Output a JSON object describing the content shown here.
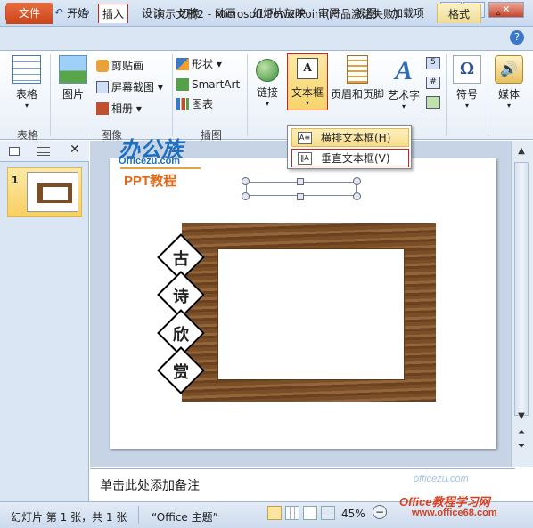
{
  "titlebar": {
    "app_icon": "P",
    "title": "演示文稿2 - Microsoft PowerPoint(产品激活失败)",
    "min": "–",
    "max": "□",
    "close": "✕"
  },
  "tabs": {
    "file": "文件",
    "home": "开始",
    "insert": "插入",
    "design": "设计",
    "transitions": "切换",
    "animations": "动画",
    "slideshow": "幻灯片放映",
    "review": "审阅",
    "view": "视图",
    "addins": "加载项",
    "format": "格式"
  },
  "ribbon": {
    "table": "表格",
    "picture": "图片",
    "clipart": "剪贴画",
    "screenshot": "屏幕截图",
    "album": "相册",
    "shapes": "形状",
    "smartart": "SmartArt",
    "chart": "图表",
    "link": "链接",
    "textbox": "文本框",
    "header_footer": "页眉和页脚",
    "wordart": "艺术字",
    "symbol": "符号",
    "media": "媒体",
    "group_table": "表格",
    "group_image": "图像",
    "group_illus": "插图"
  },
  "dropdown": {
    "horizontal": "横排文本框(H)",
    "vertical": "垂直文本框(V)"
  },
  "thumb": {
    "number": "1"
  },
  "slide": {
    "logo_main": "办公族",
    "logo_url": "Officezu.com",
    "logo_sub": "PPT教程",
    "chars": [
      "古",
      "诗",
      "欣",
      "赏"
    ]
  },
  "notes": {
    "placeholder": "单击此处添加备注"
  },
  "status": {
    "slide": "幻灯片 第 1 张，共 1 张",
    "theme": "“Office 主题”",
    "zoom": "45%"
  },
  "watermark": {
    "text": "Office教程学习网",
    "url": "www.office68.com",
    "faint": "officezu.com"
  }
}
